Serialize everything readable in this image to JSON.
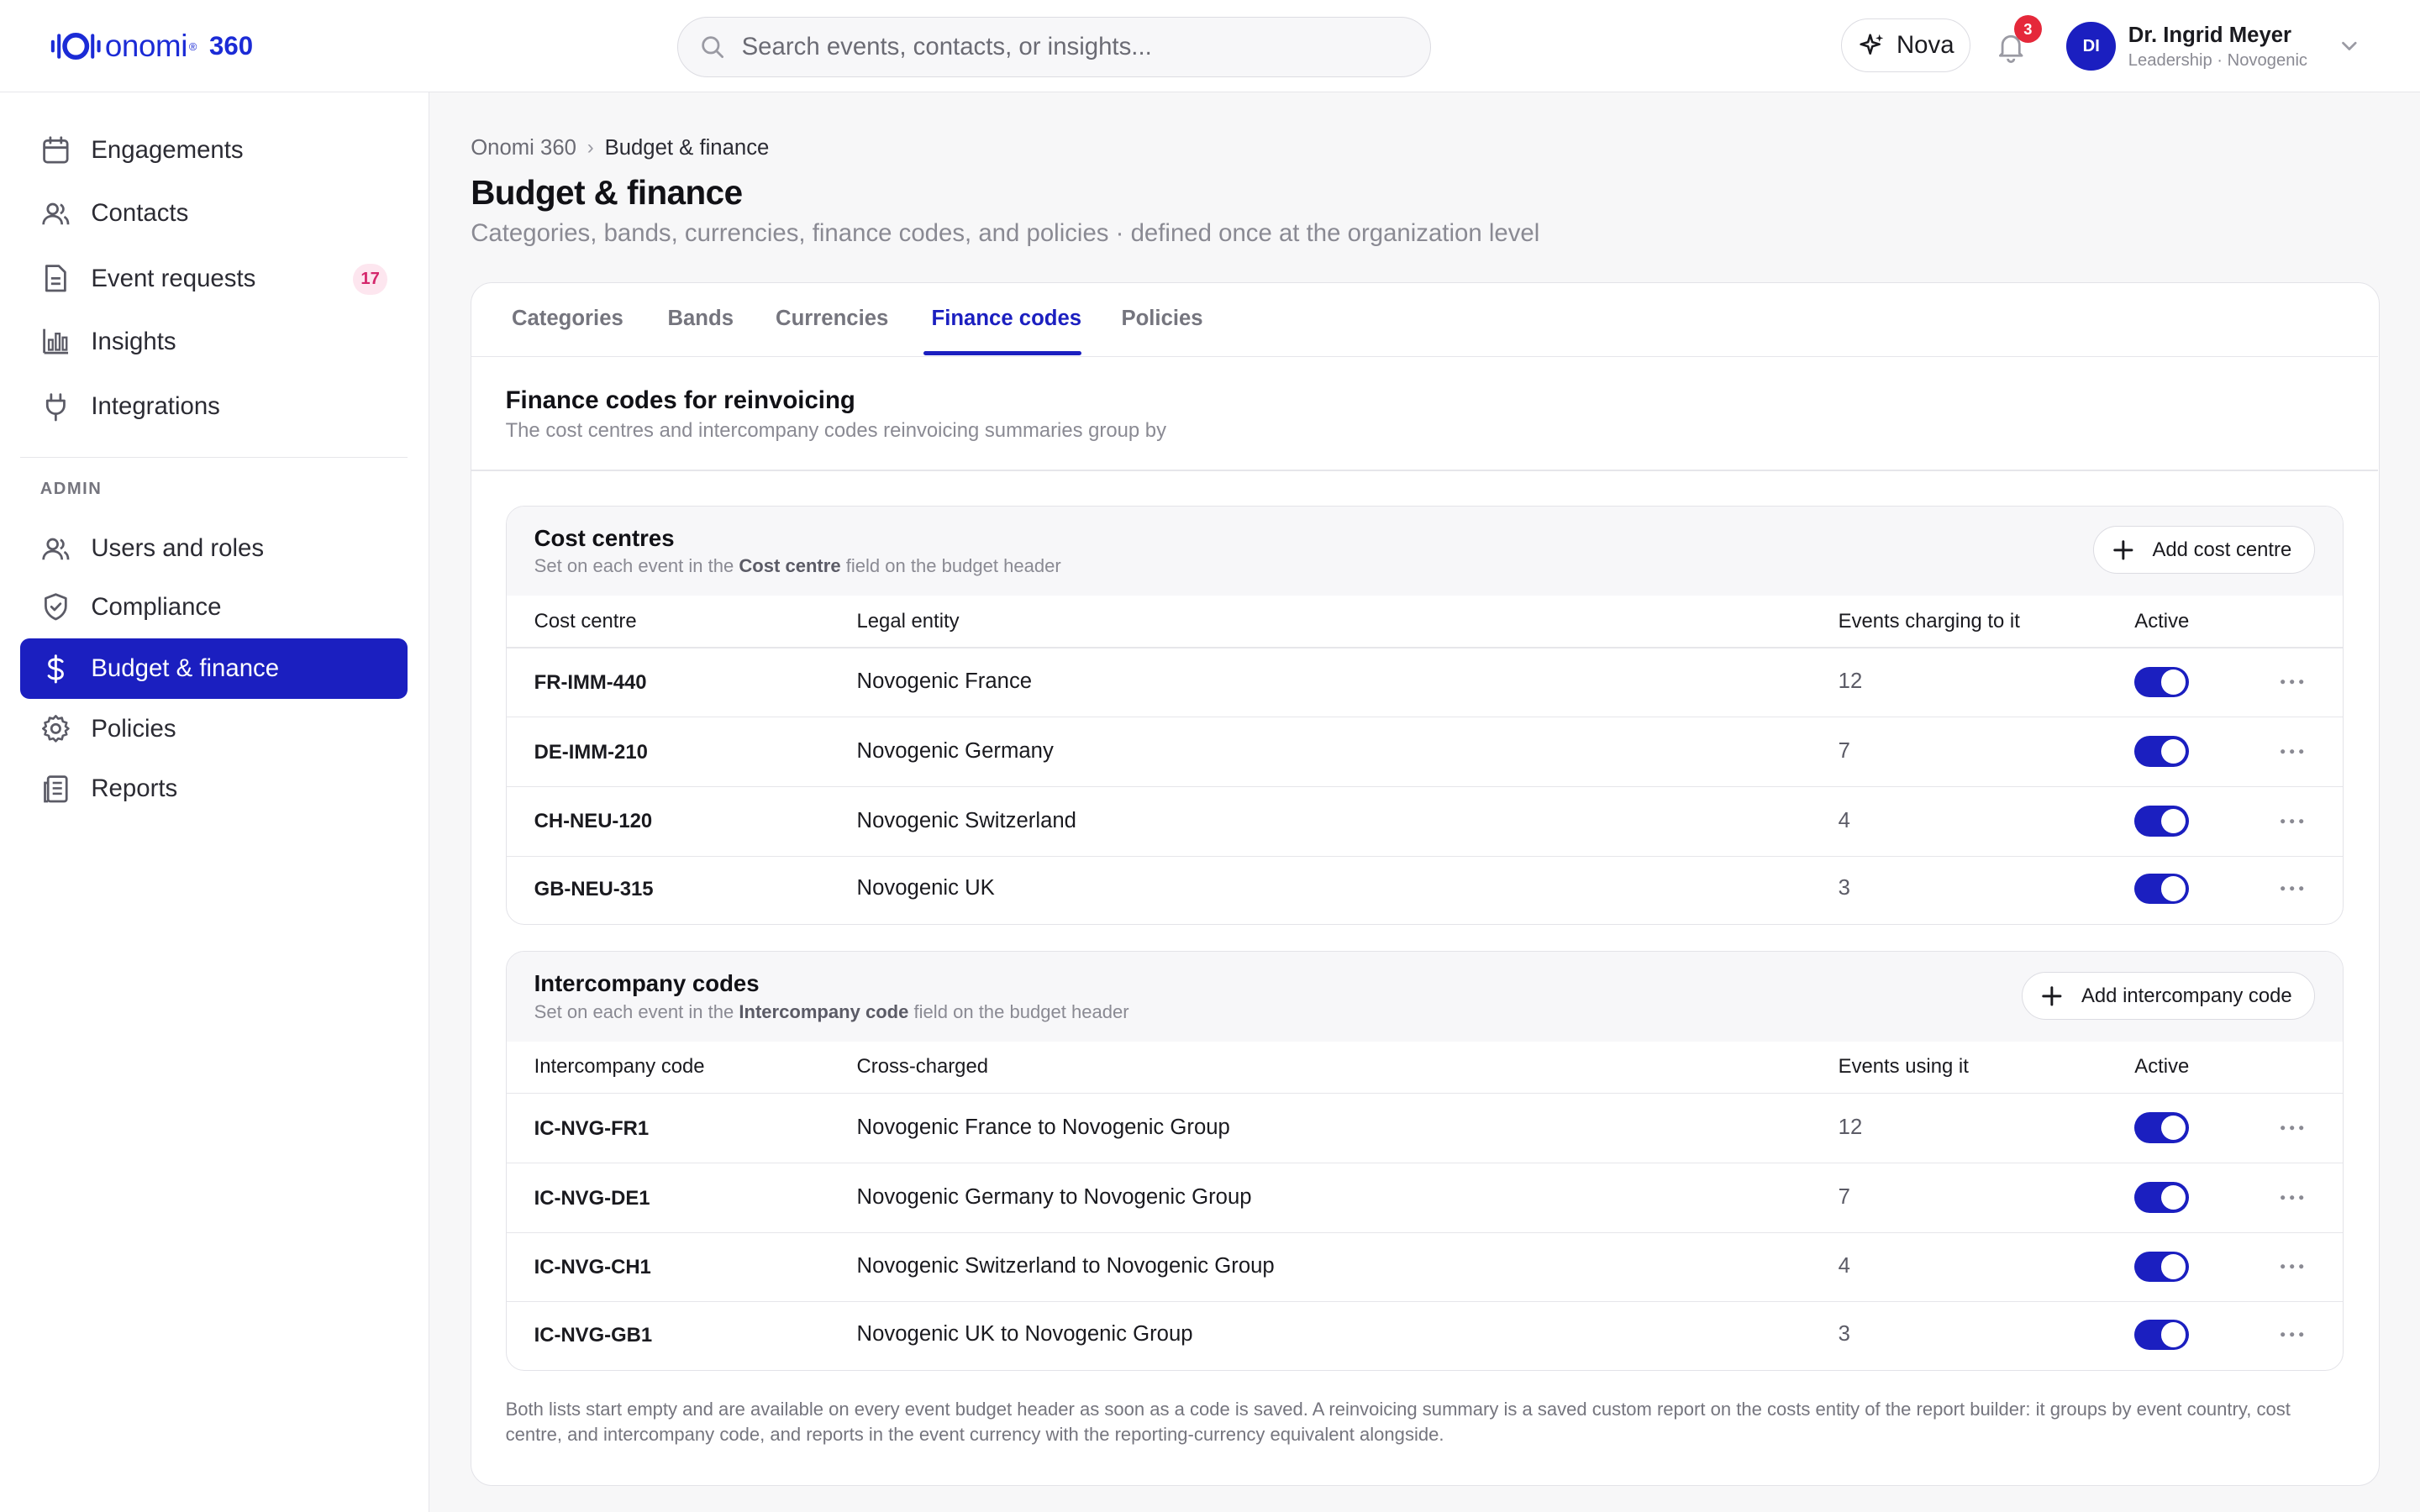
{
  "brand": {
    "name": "onomi",
    "reg": "®",
    "suffix": "360"
  },
  "search": {
    "placeholder": "Search events, contacts, or insights..."
  },
  "nova": {
    "label": "Nova"
  },
  "notifications": {
    "count": "3"
  },
  "user": {
    "initials": "DI",
    "name": "Dr. Ingrid Meyer",
    "role": "Leadership · Novogenic"
  },
  "sidebar": {
    "items": [
      {
        "label": "Engagements",
        "icon": "calendar-icon"
      },
      {
        "label": "Contacts",
        "icon": "users-icon"
      },
      {
        "label": "Event requests",
        "icon": "document-icon",
        "badge": "17"
      },
      {
        "label": "Insights",
        "icon": "bar-chart-icon"
      },
      {
        "label": "Integrations",
        "icon": "plug-icon"
      }
    ],
    "admin_label": "ADMIN",
    "admin_items": [
      {
        "label": "Users and roles",
        "icon": "users-icon"
      },
      {
        "label": "Compliance",
        "icon": "shield-icon"
      },
      {
        "label": "Budget & finance",
        "icon": "dollar-icon",
        "active": true
      },
      {
        "label": "Policies",
        "icon": "gear-icon"
      },
      {
        "label": "Reports",
        "icon": "report-icon"
      }
    ]
  },
  "breadcrumb": {
    "root": "Onomi 360",
    "separator": "›",
    "current": "Budget & finance"
  },
  "page": {
    "title": "Budget & finance",
    "subtitle": "Categories, bands, currencies, finance codes, and policies · defined once at the organization level"
  },
  "tabs": [
    {
      "label": "Categories"
    },
    {
      "label": "Bands"
    },
    {
      "label": "Currencies"
    },
    {
      "label": "Finance codes",
      "active": true
    },
    {
      "label": "Policies"
    }
  ],
  "section": {
    "title": "Finance codes for reinvoicing",
    "description": "The cost centres and intercompany codes reinvoicing summaries group by"
  },
  "cost_centres": {
    "title": "Cost centres",
    "desc_prefix": "Set on each event in the ",
    "desc_field": "Cost centre",
    "desc_suffix": " field on the budget header",
    "add_label": "Add cost centre",
    "columns": [
      "Cost centre",
      "Legal entity",
      "Events charging to it",
      "Active"
    ],
    "rows": [
      {
        "code": "FR-IMM-440",
        "entity": "Novogenic France",
        "count": "12",
        "active": true
      },
      {
        "code": "DE-IMM-210",
        "entity": "Novogenic Germany",
        "count": "7",
        "active": true
      },
      {
        "code": "CH-NEU-120",
        "entity": "Novogenic Switzerland",
        "count": "4",
        "active": true
      },
      {
        "code": "GB-NEU-315",
        "entity": "Novogenic UK",
        "count": "3",
        "active": true
      }
    ]
  },
  "intercompany": {
    "title": "Intercompany codes",
    "desc_prefix": "Set on each event in the ",
    "desc_field": "Intercompany code",
    "desc_suffix": " field on the budget header",
    "add_label": "Add intercompany code",
    "columns": [
      "Intercompany code",
      "Cross-charged",
      "Events using it",
      "Active"
    ],
    "rows": [
      {
        "code": "IC-NVG-FR1",
        "entity": "Novogenic France to Novogenic Group",
        "count": "12",
        "active": true
      },
      {
        "code": "IC-NVG-DE1",
        "entity": "Novogenic Germany to Novogenic Group",
        "count": "7",
        "active": true
      },
      {
        "code": "IC-NVG-CH1",
        "entity": "Novogenic Switzerland to Novogenic Group",
        "count": "4",
        "active": true
      },
      {
        "code": "IC-NVG-GB1",
        "entity": "Novogenic UK to Novogenic Group",
        "count": "3",
        "active": true
      }
    ]
  },
  "footnote": "Both lists start empty and are available on every event budget header as soon as a code is saved. A reinvoicing summary is a saved custom report on the costs entity of the report builder: it groups by event country, cost centre, and intercompany code, and reports in the event currency with the reporting-currency equivalent alongside.",
  "colors": {
    "accent": "#1b1fc0",
    "brand": "#1b2bd6",
    "badge_red": "#e5283a",
    "badge_pink": "#d4266b"
  }
}
